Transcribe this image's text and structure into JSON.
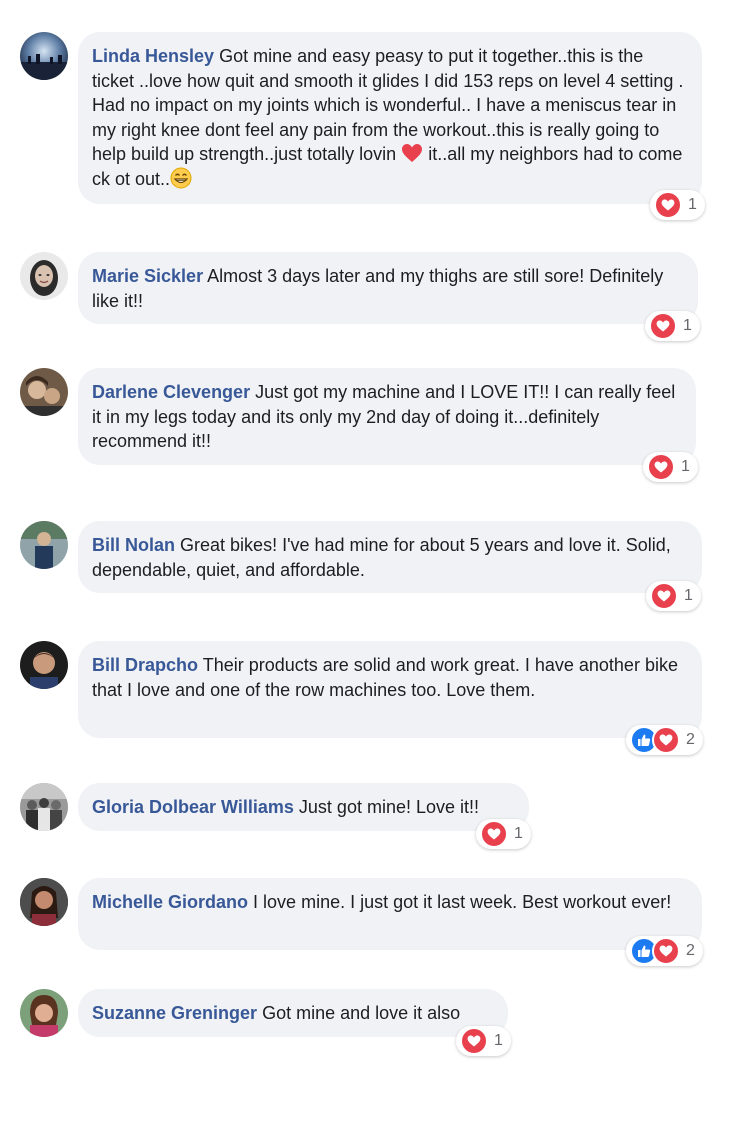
{
  "colors": {
    "author": "#385898",
    "bubble": "#f0f2f5",
    "love": "#e8414d",
    "like": "#1d7bf1"
  },
  "comments": [
    {
      "author": "Linda Hensley",
      "text_part1": "Got mine and easy peasy to put it together..this is the ticket ..love how quit and smooth it glides I did 153 reps on level 4 setting . Had no impact on my joints which is wonderful.. I have a meniscus tear in my right knee dont feel any pain from the workout..this is really going to help build up strength..just totally lovin",
      "text_part2": "it..all my neighbors had to come ck ot out..",
      "emoji_1": "red-heart",
      "emoji_2": "grinning-face",
      "reactions": [
        "love"
      ],
      "reaction_count": "1"
    },
    {
      "author": "Marie Sickler",
      "text": "Almost 3 days later and my thighs are still sore! Definitely like it!!",
      "reactions": [
        "love"
      ],
      "reaction_count": "1"
    },
    {
      "author": "Darlene Clevenger",
      "text": "Just got my machine and I LOVE IT!! I can really feel it in my legs today and its only my 2nd day of doing it...definitely recommend it!!",
      "reactions": [
        "love"
      ],
      "reaction_count": "1"
    },
    {
      "author": "Bill Nolan",
      "text": "Great bikes! I've had mine for about 5 years and love it. Solid, dependable, quiet, and affordable.",
      "reactions": [
        "love"
      ],
      "reaction_count": "1"
    },
    {
      "author": "Bill Drapcho",
      "text": "Their products are solid and work great. I have another bike that I love and one of the row machines too. Love them.",
      "reactions": [
        "like",
        "love"
      ],
      "reaction_count": "2"
    },
    {
      "author": "Gloria Dolbear Williams",
      "text": "Just got mine! Love it!!",
      "reactions": [
        "love"
      ],
      "reaction_count": "1"
    },
    {
      "author": "Michelle Giordano",
      "text": "I love mine. I just got it last week. Best workout ever!",
      "reactions": [
        "like",
        "love"
      ],
      "reaction_count": "2"
    },
    {
      "author": "Suzanne Greninger",
      "text": "Got mine and love it also",
      "reactions": [
        "love"
      ],
      "reaction_count": "1"
    }
  ]
}
